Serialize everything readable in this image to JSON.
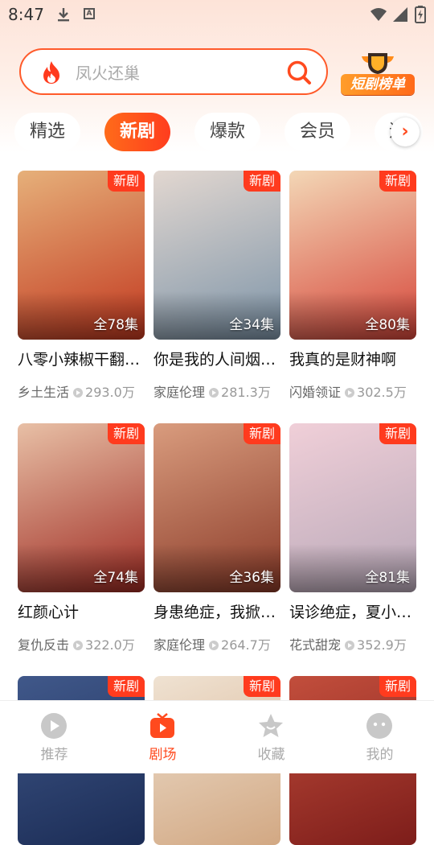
{
  "status_bar": {
    "time": "8:47"
  },
  "search": {
    "placeholder": "凤火还巢"
  },
  "rank_button": {
    "label": "短剧榜单"
  },
  "tabs": [
    {
      "label": "精选"
    },
    {
      "label": "新剧"
    },
    {
      "label": "爆款"
    },
    {
      "label": "会员"
    },
    {
      "label": "追"
    }
  ],
  "cards": [
    {
      "badge": "新剧",
      "episodes": "全78集",
      "title": "八零小辣椒干翻…",
      "genre": "乡土生活",
      "views": "293.0万",
      "colors": [
        "#c2381f",
        "#e6b07a"
      ]
    },
    {
      "badge": "新剧",
      "episodes": "全34集",
      "title": "你是我的人间烟…",
      "genre": "家庭伦理",
      "views": "281.3万",
      "colors": [
        "#7d94a8",
        "#e2d7d0"
      ]
    },
    {
      "badge": "新剧",
      "episodes": "全80集",
      "title": "我真的是财神啊",
      "genre": "闪婚领证",
      "views": "302.5万",
      "colors": [
        "#d6463a",
        "#f3d7b6"
      ]
    },
    {
      "badge": "新剧",
      "episodes": "全74集",
      "title": "红颜心计",
      "genre": "复仇反击",
      "views": "322.0万",
      "colors": [
        "#9e2a22",
        "#e8c0a6"
      ]
    },
    {
      "badge": "新剧",
      "episodes": "全36集",
      "title": "身患绝症，我掀…",
      "genre": "家庭伦理",
      "views": "264.7万",
      "colors": [
        "#8a3a28",
        "#d99c7e"
      ]
    },
    {
      "badge": "新剧",
      "episodes": "全81集",
      "title": "误诊绝症，夏小…",
      "genre": "花式甜宠",
      "views": "352.9万",
      "colors": [
        "#b8a8b8",
        "#f0cfd8"
      ]
    },
    {
      "badge": "新剧",
      "colors": [
        "#1b2c55",
        "#40588a"
      ]
    },
    {
      "badge": "新剧",
      "colors": [
        "#d2a883",
        "#efe2d2"
      ]
    },
    {
      "badge": "新剧",
      "colors": [
        "#7d1d1a",
        "#c24e3c"
      ]
    }
  ],
  "nav": [
    {
      "label": "推荐"
    },
    {
      "label": "剧场"
    },
    {
      "label": "收藏"
    },
    {
      "label": "我的"
    }
  ],
  "accent_color": "#ff4a1e"
}
